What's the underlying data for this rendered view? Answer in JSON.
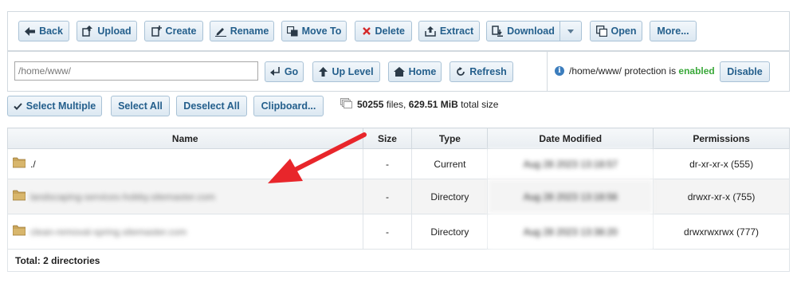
{
  "toolbar": {
    "back": "Back",
    "upload": "Upload",
    "create": "Create",
    "rename": "Rename",
    "move_to": "Move To",
    "delete": "Delete",
    "extract": "Extract",
    "download": "Download",
    "open": "Open",
    "more": "More..."
  },
  "pathbar": {
    "path_value": "/home/www/",
    "go": "Go",
    "up_level": "Up Level",
    "home": "Home",
    "refresh": "Refresh"
  },
  "protection": {
    "path": "/home/www/",
    "text": " protection is ",
    "status": "enabled",
    "disable": "Disable"
  },
  "selection": {
    "select_multiple": "Select Multiple",
    "select_all": "Select All",
    "deselect_all": "Deselect All",
    "clipboard": "Clipboard..."
  },
  "summary": {
    "files_count": "50255",
    "files_label": " files, ",
    "total_size": "629.51 MiB",
    "size_label": " total size"
  },
  "table": {
    "headers": [
      "Name",
      "Size",
      "Type",
      "Date Modified",
      "Permissions"
    ],
    "rows": [
      {
        "name": "./",
        "size": "-",
        "type": "Current",
        "date": "Aug 28 2023 13:18:57",
        "permissions": "dr-xr-xr-x (555)"
      },
      {
        "name": "landscaping-services-hobby.sitemaster.com",
        "size": "-",
        "type": "Directory",
        "date": "Aug 28 2023 13:18:56",
        "permissions": "drwxr-xr-x (755)"
      },
      {
        "name": "clean-removal-spring.sitemaster.com",
        "size": "-",
        "type": "Directory",
        "date": "Aug 28 2023 13:38:20",
        "permissions": "drwxrwxrwx (777)"
      }
    ],
    "footer": "Total: 2 directories"
  },
  "colors": {
    "button_text": "#245f8c",
    "enabled": "#3aa83a",
    "arrow": "#e8262b",
    "delete_icon": "#d42a2a"
  }
}
